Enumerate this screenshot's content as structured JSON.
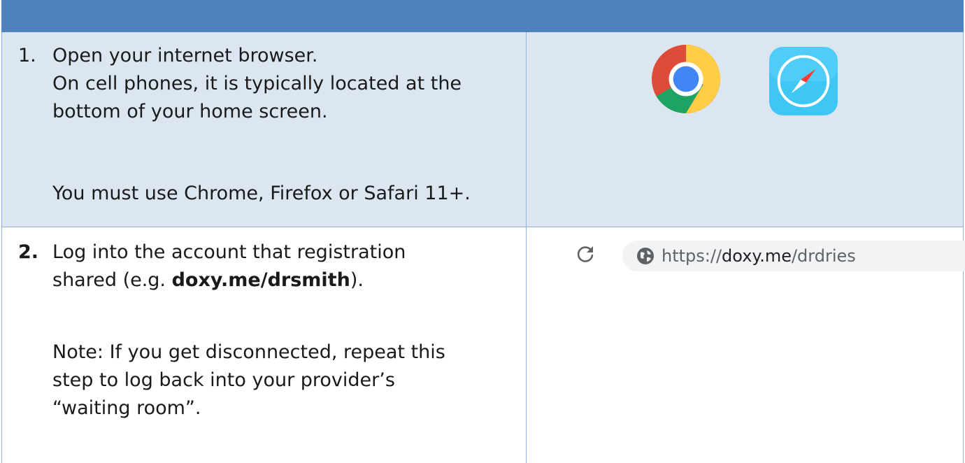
{
  "step1": {
    "number": "1.",
    "lines": [
      "Open your internet browser.",
      "On cell phones, it is typically located at the",
      "bottom of your home screen.",
      "You must use Chrome, Firefox or Safari 11+."
    ],
    "icons": [
      "chrome-icon",
      "safari-icon"
    ]
  },
  "step2": {
    "number": "2.",
    "line1": "Log into the account that registration",
    "line2_pre": "shared (e.g. ",
    "line2_bold": "doxy.me/drsmith",
    "line2_post": ").",
    "note_lines": [
      "Note: If you get disconnected, repeat this",
      "step to log back into your provider’s",
      "“waiting room”."
    ]
  },
  "address_bar": {
    "scheme": "https://",
    "domain": "doxy.me",
    "path": "/drdries",
    "icons": [
      "reload-icon",
      "globe-icon"
    ]
  },
  "colors": {
    "header": "#4f81bd",
    "row_band": "#dce6f1",
    "border": "#95b3d7"
  }
}
